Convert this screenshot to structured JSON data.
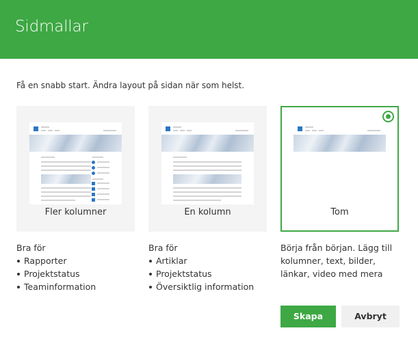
{
  "dialog": {
    "title": "Sidmallar",
    "subtitle": "Få en snabb start. Ändra layout på sidan när som helst."
  },
  "templates": [
    {
      "label": "Fler kolumner",
      "selected": false,
      "description_heading": "Bra för",
      "bullets": [
        "Rapporter",
        "Projektstatus",
        "Teaminformation"
      ]
    },
    {
      "label": "En kolumn",
      "selected": false,
      "description_heading": "Bra för",
      "bullets": [
        "Artiklar",
        "Projektstatus",
        "Översiktlig information"
      ]
    },
    {
      "label": "Tom",
      "selected": true,
      "description": "Börja från början. Lägg till kolumner, text, bilder, länkar, video med mera"
    }
  ],
  "buttons": {
    "create": "Skapa",
    "cancel": "Avbryt"
  },
  "colors": {
    "accent": "#3ea844",
    "logo": "#2b78c2"
  }
}
